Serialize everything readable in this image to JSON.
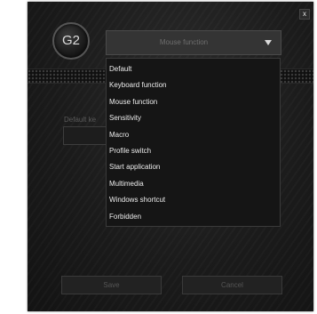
{
  "window": {
    "close_label": "x"
  },
  "profile": {
    "badge": "G2"
  },
  "function_select": {
    "value": "Mouse function",
    "options": [
      "Default",
      "Keyboard function",
      "Mouse function",
      "Sensitivity",
      "Macro",
      "Profile switch",
      "Start application",
      "Multimedia",
      "Windows shortcut",
      "Forbidden"
    ]
  },
  "background": {
    "default_key_label": "Default ke"
  },
  "footer": {
    "save_label": "Save",
    "cancel_label": "Cancel"
  }
}
